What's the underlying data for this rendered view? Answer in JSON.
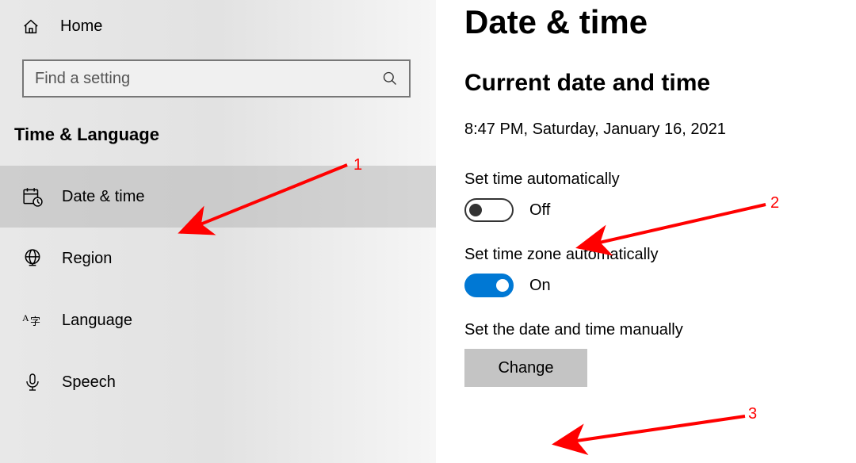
{
  "sidebar": {
    "home_label": "Home",
    "search_placeholder": "Find a setting",
    "section_title": "Time & Language",
    "items": [
      {
        "label": "Date & time"
      },
      {
        "label": "Region"
      },
      {
        "label": "Language"
      },
      {
        "label": "Speech"
      }
    ]
  },
  "main": {
    "title": "Date & time",
    "section_heading": "Current date and time",
    "current_datetime": "8:47 PM, Saturday, January 16, 2021",
    "set_time_auto_label": "Set time automatically",
    "set_time_auto_state": "Off",
    "set_tz_auto_label": "Set time zone automatically",
    "set_tz_auto_state": "On",
    "set_manual_label": "Set the date and time manually",
    "change_button": "Change"
  },
  "annotations": {
    "n1": "1",
    "n2": "2",
    "n3": "3"
  }
}
